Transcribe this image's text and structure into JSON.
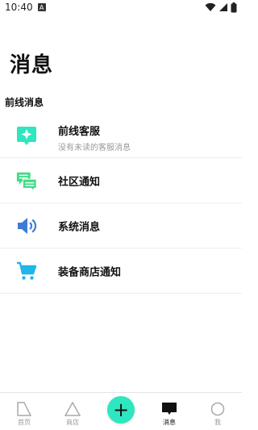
{
  "status_bar": {
    "time": "10:40",
    "notification_badge": "A"
  },
  "page": {
    "title": "消息",
    "section_title": "前线消息"
  },
  "items": [
    {
      "title": "前线客服",
      "subtitle": "没有未读的客服消息",
      "icon": "customer-service-icon",
      "color": "#2ee6bf"
    },
    {
      "title": "社区通知",
      "icon": "chat-bubbles-icon",
      "color": "#3ddc84"
    },
    {
      "title": "系统消息",
      "icon": "speaker-icon",
      "color": "#3d7bd6"
    },
    {
      "title": "装备商店通知",
      "icon": "shopping-cart-icon",
      "color": "#1fb6e8"
    }
  ],
  "nav": [
    {
      "label": "首页",
      "icon": "home-icon"
    },
    {
      "label": "商店",
      "icon": "store-triangle-icon"
    },
    {
      "label": "消息",
      "icon": "message-icon",
      "active": true
    },
    {
      "label": "我",
      "icon": "profile-circle-icon"
    }
  ],
  "fab": {
    "symbol": "+"
  },
  "colors": {
    "accent": "#2ee6bf",
    "muted": "#999999"
  }
}
